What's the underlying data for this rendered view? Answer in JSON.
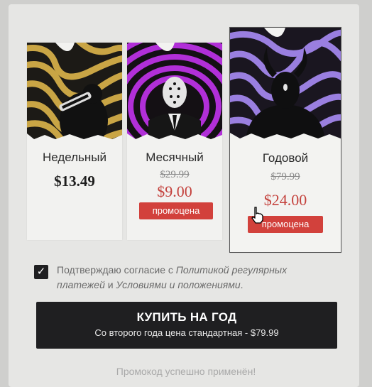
{
  "plans": [
    {
      "name": "Недельный",
      "price": "$13.49"
    },
    {
      "name": "Месячный",
      "old_price": "$29.99",
      "price": "$9.00",
      "badge": "промоцена"
    },
    {
      "name": "Годовой",
      "old_price": "$79.99",
      "price": "$24.00",
      "badge": "промоцена",
      "selected": true
    }
  ],
  "consent": {
    "checked": true,
    "prefix": "Подтверждаю согласие с ",
    "link1": "Политикой регулярных платежей",
    "middle": " и ",
    "link2": "Условиями и положениями",
    "suffix": "."
  },
  "buy_button": {
    "title": "КУПИТЬ НА ГОД",
    "subtitle": "Со второго года цена стандартная - $79.99"
  },
  "promo_message": "Промокод успешно применён!",
  "colors": {
    "accent_red": "#d2413c",
    "dark": "#1f1f21",
    "weekly_art": "#c9a545",
    "monthly_art": "#b12fd8",
    "yearly_art": "#9a7fe0"
  },
  "icons": [
    "check-icon",
    "hand-cursor-icon"
  ]
}
